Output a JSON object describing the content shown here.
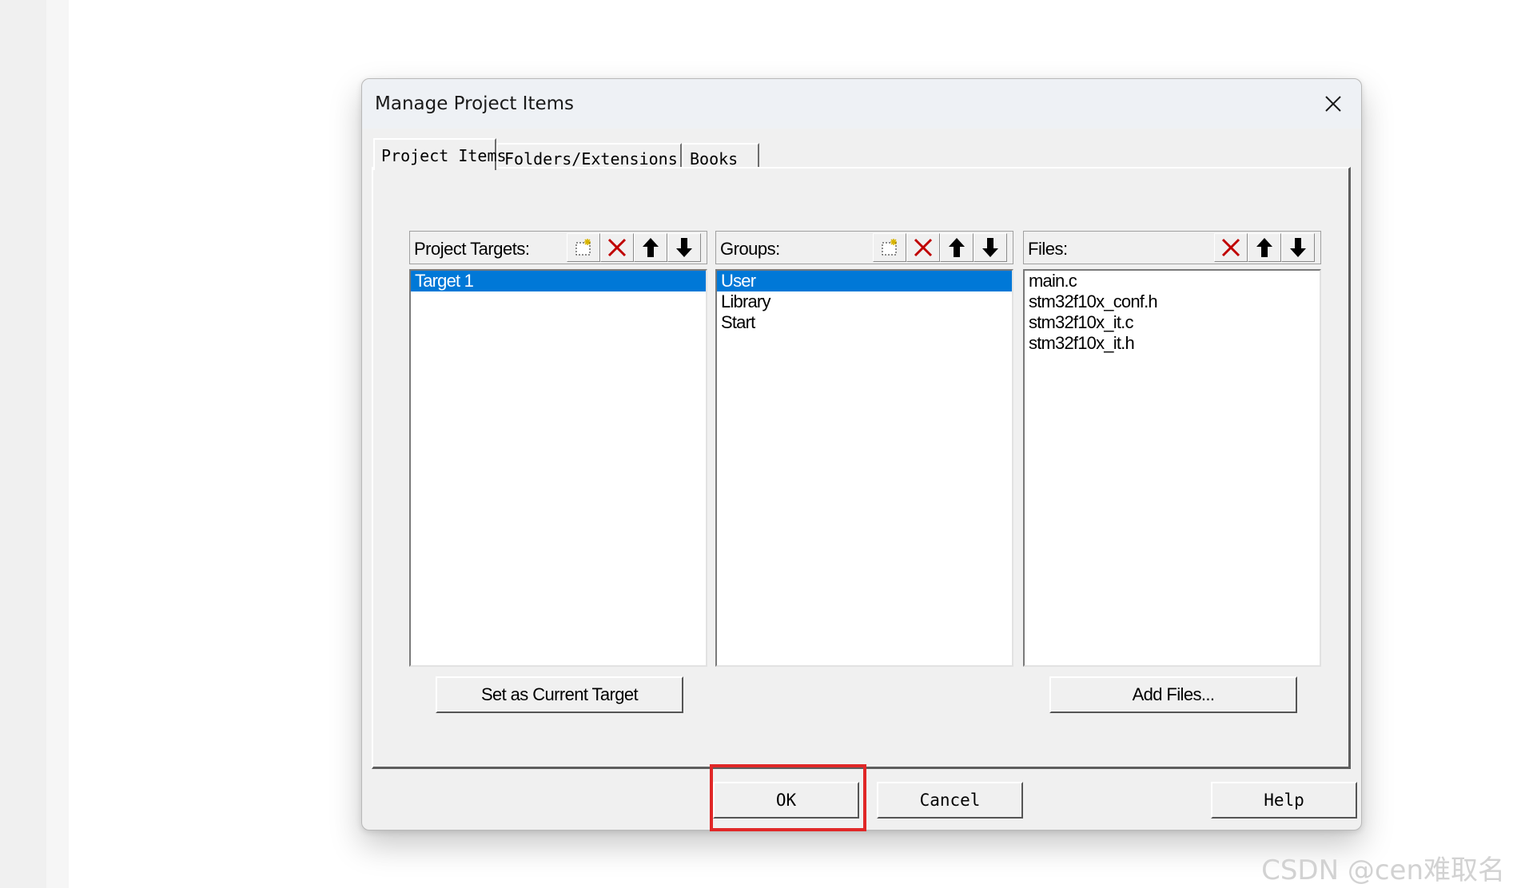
{
  "dialog": {
    "title": "Manage Project Items"
  },
  "tabs": [
    {
      "label": "Project Items",
      "active": true
    },
    {
      "label": "Folders/Extensions",
      "active": false
    },
    {
      "label": "Books",
      "active": false
    }
  ],
  "targets": {
    "label": "Project Targets:",
    "items": [
      "Target 1"
    ],
    "selected": "Target 1",
    "action_label": "Set as Current Target"
  },
  "groups": {
    "label": "Groups:",
    "items": [
      "User",
      "Library",
      "Start"
    ],
    "selected": "User"
  },
  "files": {
    "label": "Files:",
    "items": [
      "main.c",
      "stm32f10x_conf.h",
      "stm32f10x_it.c",
      "stm32f10x_it.h"
    ],
    "action_label": "Add Files..."
  },
  "footer": {
    "ok_label": "OK",
    "cancel_label": "Cancel",
    "help_label": "Help"
  },
  "watermark": "CSDN @cen难取名",
  "colors": {
    "selection": "#0078d7",
    "highlight_box": "#e02727",
    "delete_icon": "#c00000"
  }
}
